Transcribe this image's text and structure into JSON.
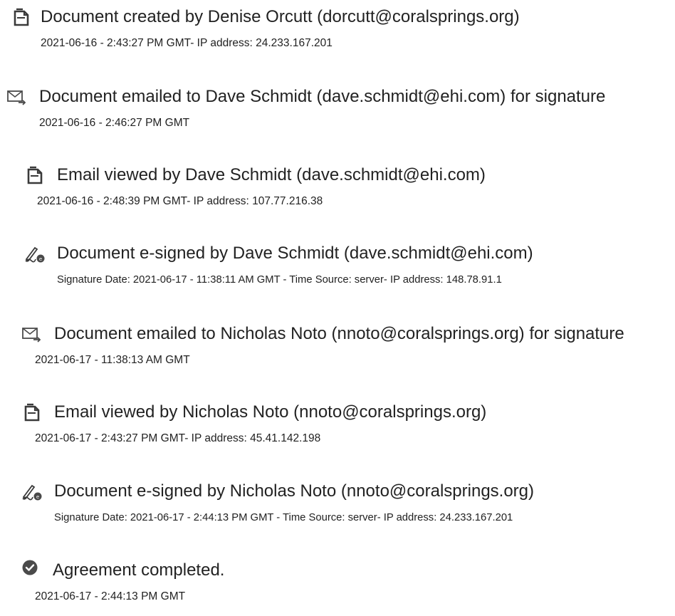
{
  "events": [
    {
      "icon": "document-icon",
      "title": "Document created by Denise Orcutt (dorcutt@coralsprings.org)",
      "detail": "2021-06-16 - 2:43:27 PM GMT- IP address: 24.233.167.201"
    },
    {
      "icon": "email-sent-icon",
      "title": "Document emailed to Dave Schmidt (dave.schmidt@ehi.com) for signature",
      "detail": "2021-06-16 - 2:46:27 PM GMT"
    },
    {
      "icon": "document-icon",
      "title": "Email viewed by Dave Schmidt (dave.schmidt@ehi.com)",
      "detail": "2021-06-16 - 2:48:39 PM GMT- IP address: 107.77.216.38"
    },
    {
      "icon": "e-sign-pen-icon",
      "title": "Document e-signed by Dave Schmidt (dave.schmidt@ehi.com)",
      "detail": "Signature Date: 2021-06-17 - 11:38:11 AM GMT - Time Source: server- IP address: 148.78.91.1"
    },
    {
      "icon": "email-sent-icon",
      "title": "Document emailed to Nicholas Noto (nnoto@coralsprings.org) for signature",
      "detail": "2021-06-17 - 11:38:13 AM GMT"
    },
    {
      "icon": "document-icon",
      "title": "Email viewed by Nicholas Noto (nnoto@coralsprings.org)",
      "detail": "2021-06-17 - 2:43:27 PM GMT- IP address: 45.41.142.198"
    },
    {
      "icon": "e-sign-pen-icon",
      "title": "Document e-signed by Nicholas Noto (nnoto@coralsprings.org)",
      "detail": "Signature Date: 2021-06-17 - 2:44:13 PM GMT - Time Source: server- IP address: 24.233.167.201"
    },
    {
      "icon": "check-circle-icon",
      "title": "Agreement completed.",
      "detail": "2021-06-17 - 2:44:13 PM GMT"
    }
  ]
}
